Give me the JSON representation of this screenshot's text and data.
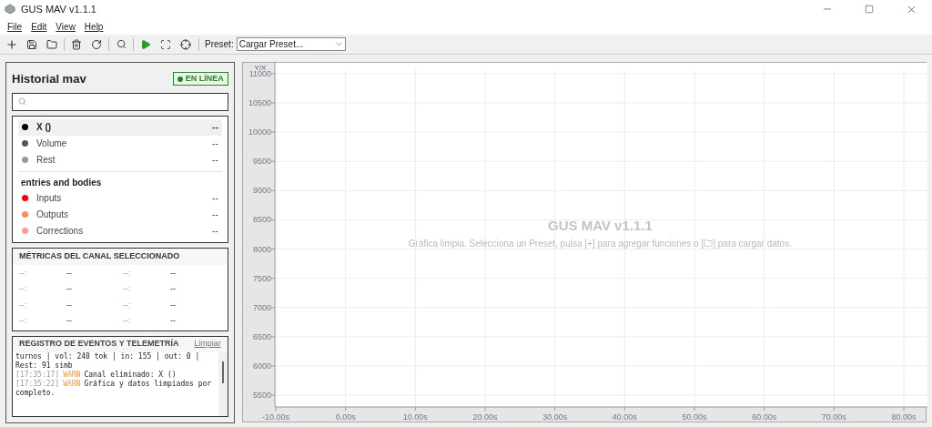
{
  "window": {
    "title": "GUS MAV v1.1.1"
  },
  "menu": [
    {
      "label": "File"
    },
    {
      "label": "Edit"
    },
    {
      "label": "View"
    },
    {
      "label": "Help"
    }
  ],
  "toolbar": {
    "preset_label": "Preset:",
    "preset_value": "Cargar Preset..."
  },
  "sidebar": {
    "title": "Historial mav",
    "status": "EN LÍNEA",
    "online": true,
    "groups": [
      {
        "items": [
          {
            "name": "X ()",
            "value": "--",
            "color": "#000000",
            "selected": true
          },
          {
            "name": "Volume",
            "value": "--",
            "color": "#555555",
            "selected": false
          },
          {
            "name": "Rest",
            "value": "--",
            "color": "#999999",
            "selected": false
          }
        ]
      },
      {
        "title": "entries and bodies",
        "items": [
          {
            "name": "Inputs",
            "value": "--",
            "color": "#ff0000",
            "selected": false
          },
          {
            "name": "Outputs",
            "value": "--",
            "color": "#ff8c5a",
            "selected": false
          },
          {
            "name": "Corrections",
            "value": "--",
            "color": "#ff9a9a",
            "selected": false
          }
        ]
      }
    ],
    "metrics": {
      "title": "MÉTRICAS DEL CANAL SELECCIONADO",
      "items": [
        {
          "label": "--:",
          "value": "--"
        },
        {
          "label": "--:",
          "value": "--"
        },
        {
          "label": "--:",
          "value": "--"
        },
        {
          "label": "--:",
          "value": "--"
        },
        {
          "label": "--:",
          "value": "--"
        },
        {
          "label": "--:",
          "value": "--"
        },
        {
          "label": "--:",
          "value": "--"
        },
        {
          "label": "--:",
          "value": "--"
        }
      ]
    },
    "log": {
      "title": "REGISTRO DE EVENTOS Y TELEMETRÍA",
      "clear": "Limpiar",
      "entries": [
        {
          "kind": "plain",
          "text": "turnos | vol: 240 tok | in: 155 | out: 0 |"
        },
        {
          "kind": "plain",
          "text": "Rest: 91 simb"
        },
        {
          "kind": "event",
          "time": "[17:35:17]",
          "level": "WARN",
          "message": "Canal eliminado: X ()"
        },
        {
          "kind": "event",
          "time": "[17:35:22]",
          "level": "WARN",
          "message": "Gráfica y datos limpiados por completo."
        }
      ]
    }
  },
  "chart": {
    "corner_label": "Y/X",
    "empty_title": "GUS MAV v1.1.1",
    "empty_text_before": "Gráfica limpia. Selecciona un Preset, pulsa [+] para agregar funciones o [",
    "empty_text_after": "] para cargar datos.",
    "chart_data": {
      "type": "line",
      "grid": true,
      "xlim": [
        -10,
        83
      ],
      "ylim": [
        5300,
        11060
      ],
      "xticks": [
        {
          "value": -10,
          "label": "-10.00s"
        },
        {
          "value": 0,
          "label": "0.00s"
        },
        {
          "value": 10,
          "label": "10.00s"
        },
        {
          "value": 20,
          "label": "20.00s"
        },
        {
          "value": 30,
          "label": "30.00s"
        },
        {
          "value": 40,
          "label": "40.00s"
        },
        {
          "value": 50,
          "label": "50.00s"
        },
        {
          "value": 60,
          "label": "60.00s"
        },
        {
          "value": 70,
          "label": "70.00s"
        },
        {
          "value": 80,
          "label": "80.00s"
        }
      ],
      "yticks": [
        5500,
        6000,
        6500,
        7000,
        7500,
        8000,
        8500,
        9000,
        9500,
        10000,
        10500,
        11000
      ]
    }
  }
}
